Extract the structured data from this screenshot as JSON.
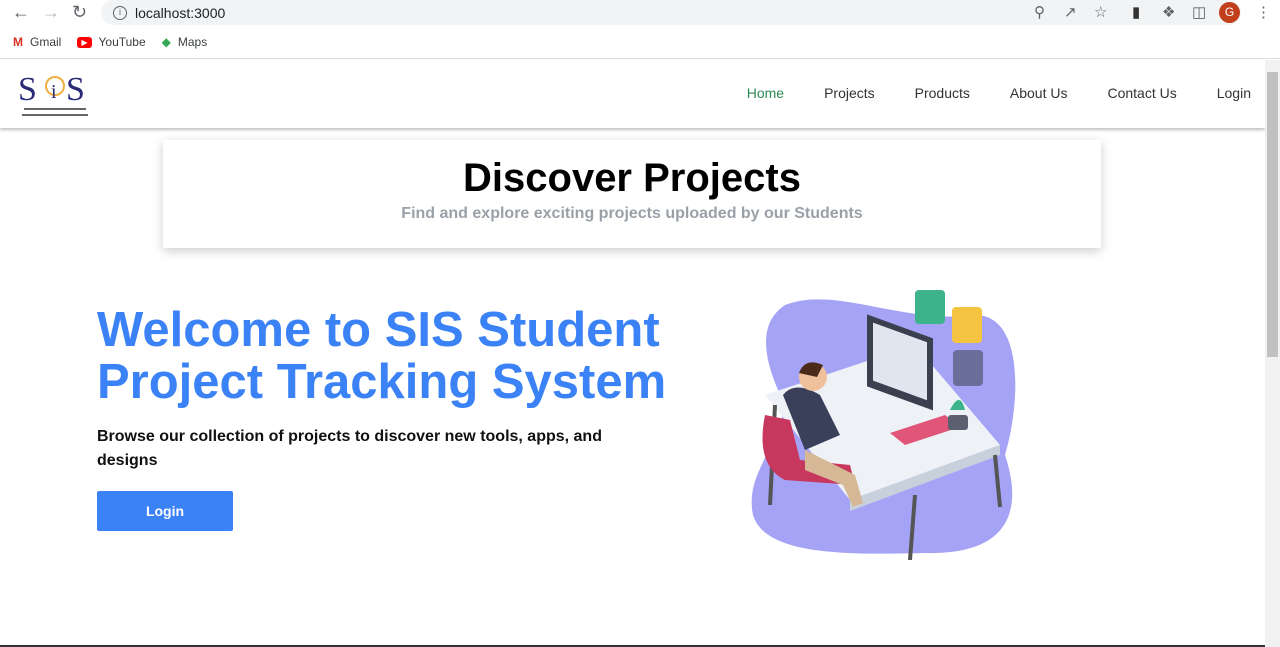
{
  "browser": {
    "url": "localhost:3000",
    "avatar_letter": "G",
    "bookmarks": [
      {
        "label": "Gmail"
      },
      {
        "label": "YouTube"
      },
      {
        "label": "Maps"
      }
    ]
  },
  "nav": {
    "logo_text": "SIS",
    "links": [
      {
        "label": "Home"
      },
      {
        "label": "Projects"
      },
      {
        "label": "Products"
      },
      {
        "label": "About Us"
      },
      {
        "label": "Contact Us"
      },
      {
        "label": "Login"
      }
    ]
  },
  "banner": {
    "title": "Discover Projects",
    "subtitle": "Find and explore exciting projects uploaded by our Students"
  },
  "hero": {
    "title": "Welcome to SIS Student Project Tracking System",
    "subtitle": "Browse our collection of projects to discover new tools, apps, and designs",
    "button": "Login"
  },
  "colors": {
    "accent": "#3b82f6",
    "active_link": "#2e8b57"
  }
}
